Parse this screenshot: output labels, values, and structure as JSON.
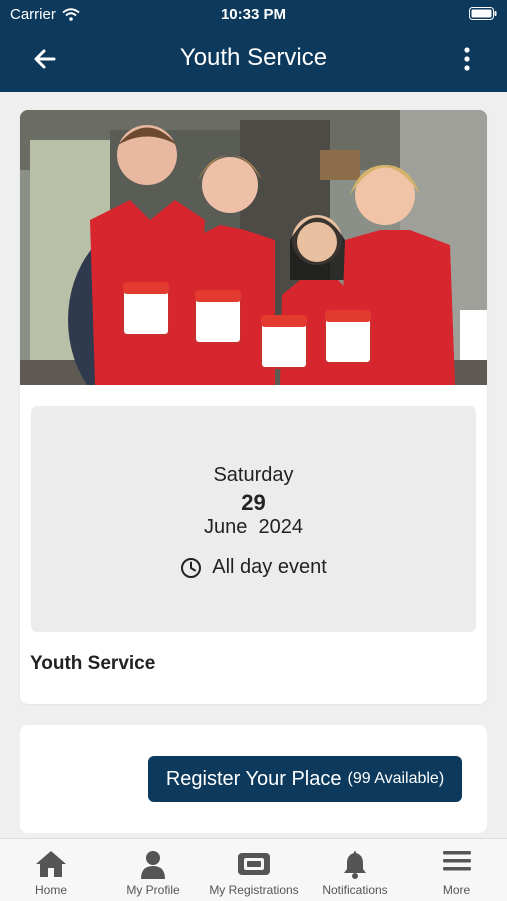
{
  "status_bar": {
    "carrier": "Carrier",
    "time": "10:33 PM"
  },
  "header": {
    "title": "Youth Service"
  },
  "event": {
    "weekday": "Saturday",
    "day": "29",
    "month_year": "June  2024",
    "time_label": "All day event",
    "title": "Youth Service"
  },
  "register": {
    "label": "Register Your Place",
    "availability": "(99 Available)"
  },
  "tabs": [
    {
      "label": "Home",
      "icon": "home-icon"
    },
    {
      "label": "My Profile",
      "icon": "person-icon"
    },
    {
      "label": "My Registrations",
      "icon": "ticket-icon"
    },
    {
      "label": "Notifications",
      "icon": "bell-icon"
    },
    {
      "label": "More",
      "icon": "menu-icon"
    }
  ],
  "colors": {
    "primary": "#0d3a5c",
    "background": "#efefef",
    "vest_red": "#d8262e"
  }
}
